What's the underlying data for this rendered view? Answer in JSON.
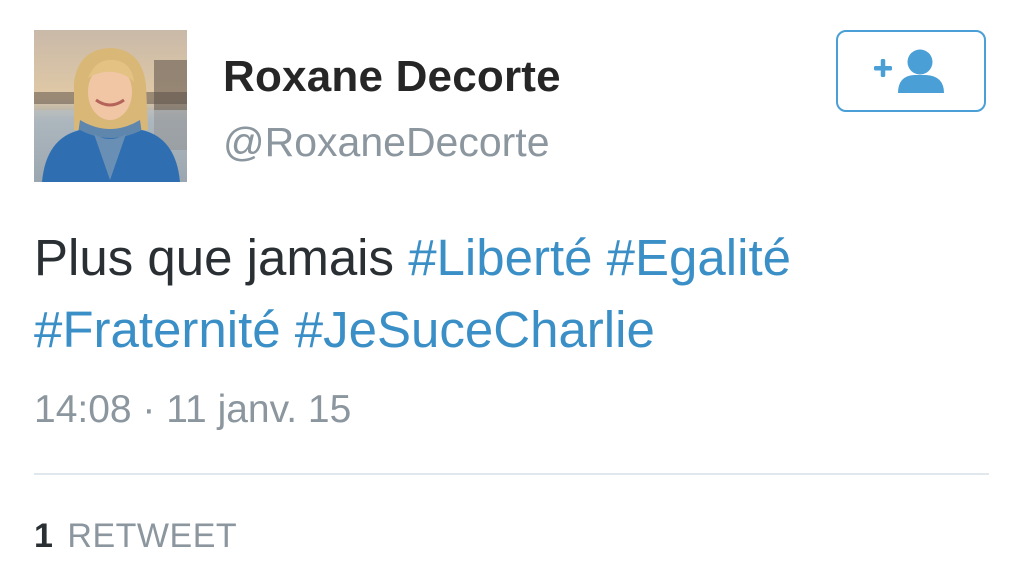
{
  "user": {
    "name": "Roxane Decorte",
    "handle": "@RoxaneDecorte",
    "avatar_icon": "profile-photo"
  },
  "follow_button": {
    "icon": "add-user-icon",
    "color": "#4a9fd6"
  },
  "tweet": {
    "segments": [
      {
        "text": "Plus que jamais ",
        "type": "text"
      },
      {
        "text": "#Liberté",
        "type": "hashtag"
      },
      {
        "text": " ",
        "type": "text"
      },
      {
        "text": "#Egalité",
        "type": "hashtag"
      },
      {
        "text": " ",
        "type": "text"
      },
      {
        "text": "#Fraternité",
        "type": "hashtag"
      },
      {
        "text": " ",
        "type": "text"
      },
      {
        "text": "#JeSuceCharlie",
        "type": "hashtag"
      }
    ],
    "timestamp": "14:08 · 11 janv. 15"
  },
  "stats": {
    "retweet_count": "1",
    "retweet_label": "RETWEET"
  },
  "colors": {
    "hashtag": "#3b8fc7",
    "secondary_text": "#8b969e",
    "primary_text": "#292f33"
  }
}
